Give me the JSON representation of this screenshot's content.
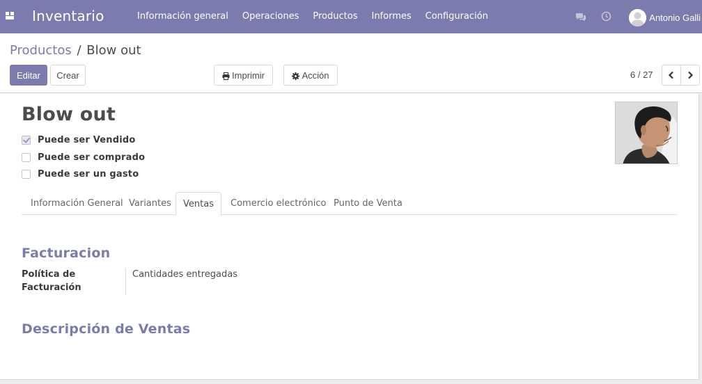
{
  "navbar": {
    "app_title": "Inventario",
    "menu": [
      "Información general",
      "Operaciones",
      "Productos",
      "Informes",
      "Configuración"
    ],
    "user_name": "Antonio Galli",
    "icons": {
      "apps": "apps-grid-icon",
      "chat": "chat-bubbles-icon",
      "activity": "clock-icon",
      "avatar": "user-avatar"
    },
    "color": "#7c7bad"
  },
  "breadcrumb": {
    "parent": "Productos",
    "separator": "/",
    "current": "Blow out"
  },
  "buttons": {
    "edit": "Editar",
    "create": "Crear",
    "print": "Imprimir",
    "action": "Acción"
  },
  "pager": {
    "value": "6 / 27"
  },
  "product": {
    "name": "Blow out",
    "checkboxes": [
      {
        "label": "Puede ser Vendido",
        "checked": true
      },
      {
        "label": "Puede ser comprado",
        "checked": false
      },
      {
        "label": "Puede ser un gasto",
        "checked": false
      }
    ]
  },
  "tabs": [
    {
      "label": "Información General",
      "active": false
    },
    {
      "label": "Variantes",
      "active": false
    },
    {
      "label": "Ventas",
      "active": true
    },
    {
      "label": "Comercio electrónico",
      "active": false
    },
    {
      "label": "Punto de Venta",
      "active": false
    }
  ],
  "sales_tab": {
    "invoicing_title": "Facturacion",
    "invoicing_policy_label": "Política de Facturación",
    "invoicing_policy_value": "Cantidades entregadas",
    "sales_description_title": "Descripción de Ventas"
  },
  "colors": {
    "accent": "#7c7bad",
    "text": "#4c4c4c",
    "border": "#d7d7d7"
  }
}
